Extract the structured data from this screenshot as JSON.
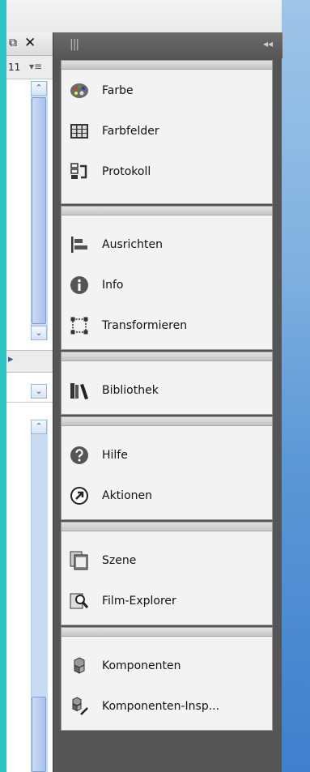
{
  "left_panel": {
    "restore_glyph": "⧉",
    "close_glyph": "✕",
    "number": "11",
    "menu_glyph": "▾≡",
    "scroll_up": "⌃",
    "scroll_down": "⌄",
    "nav_arrow": "▸",
    "dropdown_glyph": "⌄"
  },
  "dock": {
    "grip": "|||",
    "collapse": "◂◂",
    "groups": [
      {
        "items": [
          {
            "label": "Farbe",
            "icon": "palette-icon"
          },
          {
            "label": "Farbfelder",
            "icon": "swatches-icon"
          },
          {
            "label": "Protokoll",
            "icon": "history-icon"
          }
        ]
      },
      {
        "items": [
          {
            "label": "Ausrichten",
            "icon": "align-icon"
          },
          {
            "label": "Info",
            "icon": "info-icon"
          },
          {
            "label": "Transformieren",
            "icon": "transform-icon"
          }
        ]
      },
      {
        "items": [
          {
            "label": "Bibliothek",
            "icon": "library-icon"
          }
        ]
      },
      {
        "items": [
          {
            "label": "Hilfe",
            "icon": "help-icon"
          },
          {
            "label": "Aktionen",
            "icon": "actions-icon"
          }
        ]
      },
      {
        "items": [
          {
            "label": "Szene",
            "icon": "scene-icon"
          },
          {
            "label": "Film-Explorer",
            "icon": "movie-explorer-icon"
          }
        ]
      },
      {
        "items": [
          {
            "label": "Komponenten",
            "icon": "components-icon"
          },
          {
            "label": "Komponenten-Insp...",
            "icon": "component-inspector-icon"
          }
        ]
      }
    ]
  }
}
